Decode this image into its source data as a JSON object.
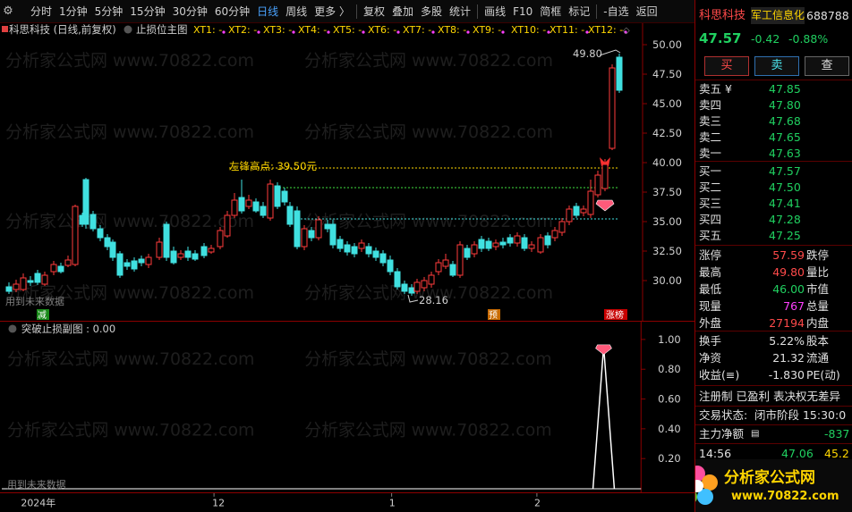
{
  "toolbar": {
    "items": [
      "分时",
      "1分钟",
      "5分钟",
      "15分钟",
      "30分钟",
      "60分钟",
      "日线",
      "周线",
      "更多 〉",
      "复权",
      "叠加",
      "多股",
      "统计",
      "画线",
      "F10",
      "简框",
      "标记",
      "-自选",
      "返回"
    ],
    "active_index": 6
  },
  "main": {
    "stock_title": "科思科技 (日线,前复权)",
    "indicator_name": "止损位主图",
    "xt_labels": [
      "XT1: -",
      "XT2: -",
      "XT3: -",
      "XT4: -",
      "XT5: -",
      "XT6: -",
      "XT7: -",
      "XT8: -",
      "XT9: -",
      "XT10: -",
      "XT11: -",
      "XT12: -"
    ],
    "high_label": "49.80",
    "low_label": "28.16",
    "annotation": "左锋高点: 39.50元",
    "future_text": "用到未来数据",
    "marker_reduce": "减",
    "marker_pre": "预",
    "marker_limit": "涨榜",
    "y_ticks": [
      "50.00",
      "47.50",
      "45.00",
      "42.50",
      "40.00",
      "37.50",
      "35.00",
      "32.50",
      "30.00"
    ]
  },
  "watermark": "分析家公式网 www.70822.com",
  "sub": {
    "title": "突破止损副图 : 0.00",
    "future_text": "用到未来数据",
    "y_ticks": [
      "1.00",
      "0.80",
      "0.60",
      "0.40",
      "0.20"
    ]
  },
  "time_axis": {
    "labels": [
      "2024年",
      "12",
      "1",
      "2"
    ]
  },
  "quote": {
    "name": "科思科技",
    "industry": "军工信息化",
    "code": "688788",
    "price": "47.57",
    "change": "-0.42",
    "change_pct": "-0.88%",
    "buy_label": "买",
    "sell_label": "卖",
    "check_label": "查",
    "asks": [
      {
        "label": "卖五 ¥",
        "price": "47.85"
      },
      {
        "label": "卖四",
        "price": "47.80"
      },
      {
        "label": "卖三",
        "price": "47.68"
      },
      {
        "label": "卖二",
        "price": "47.65"
      },
      {
        "label": "卖一",
        "price": "47.63"
      }
    ],
    "bids": [
      {
        "label": "买一",
        "price": "47.57"
      },
      {
        "label": "买二",
        "price": "47.50"
      },
      {
        "label": "买三",
        "price": "47.41"
      },
      {
        "label": "买四",
        "price": "47.28"
      },
      {
        "label": "买五",
        "price": "47.25"
      }
    ],
    "stats": [
      {
        "label": "涨停",
        "value": "57.59",
        "tail": "跌停",
        "color": "red"
      },
      {
        "label": "最高",
        "value": "49.80",
        "tail": "量比",
        "color": "red"
      },
      {
        "label": "最低",
        "value": "46.00",
        "tail": "市值",
        "color": "green"
      },
      {
        "label": "现量",
        "value": "767",
        "tail": "总量",
        "color": "magenta"
      },
      {
        "label": "外盘",
        "value": "27194",
        "tail": "内盘",
        "color": "red"
      }
    ],
    "stats2": [
      {
        "label": "换手",
        "value": "5.22%",
        "tail": "股本"
      },
      {
        "label": "净资",
        "value": "21.32",
        "tail": "流通"
      },
      {
        "label": "收益(≡)",
        "value": "-1.830",
        "tail": "PE(动)"
      }
    ],
    "reg_line": "注册制 已盈利 表决权无差异",
    "trade_status_label": "交易状态:",
    "trade_status": "闭市阶段 15:30:0",
    "net_inflow_label": "主力净额",
    "net_inflow": "-837",
    "tick_time": "14:56",
    "tick_price": "47.06",
    "tick_extra": "45.2"
  },
  "logo": {
    "text": "分析家公式网",
    "url": "www.70822.com"
  }
}
